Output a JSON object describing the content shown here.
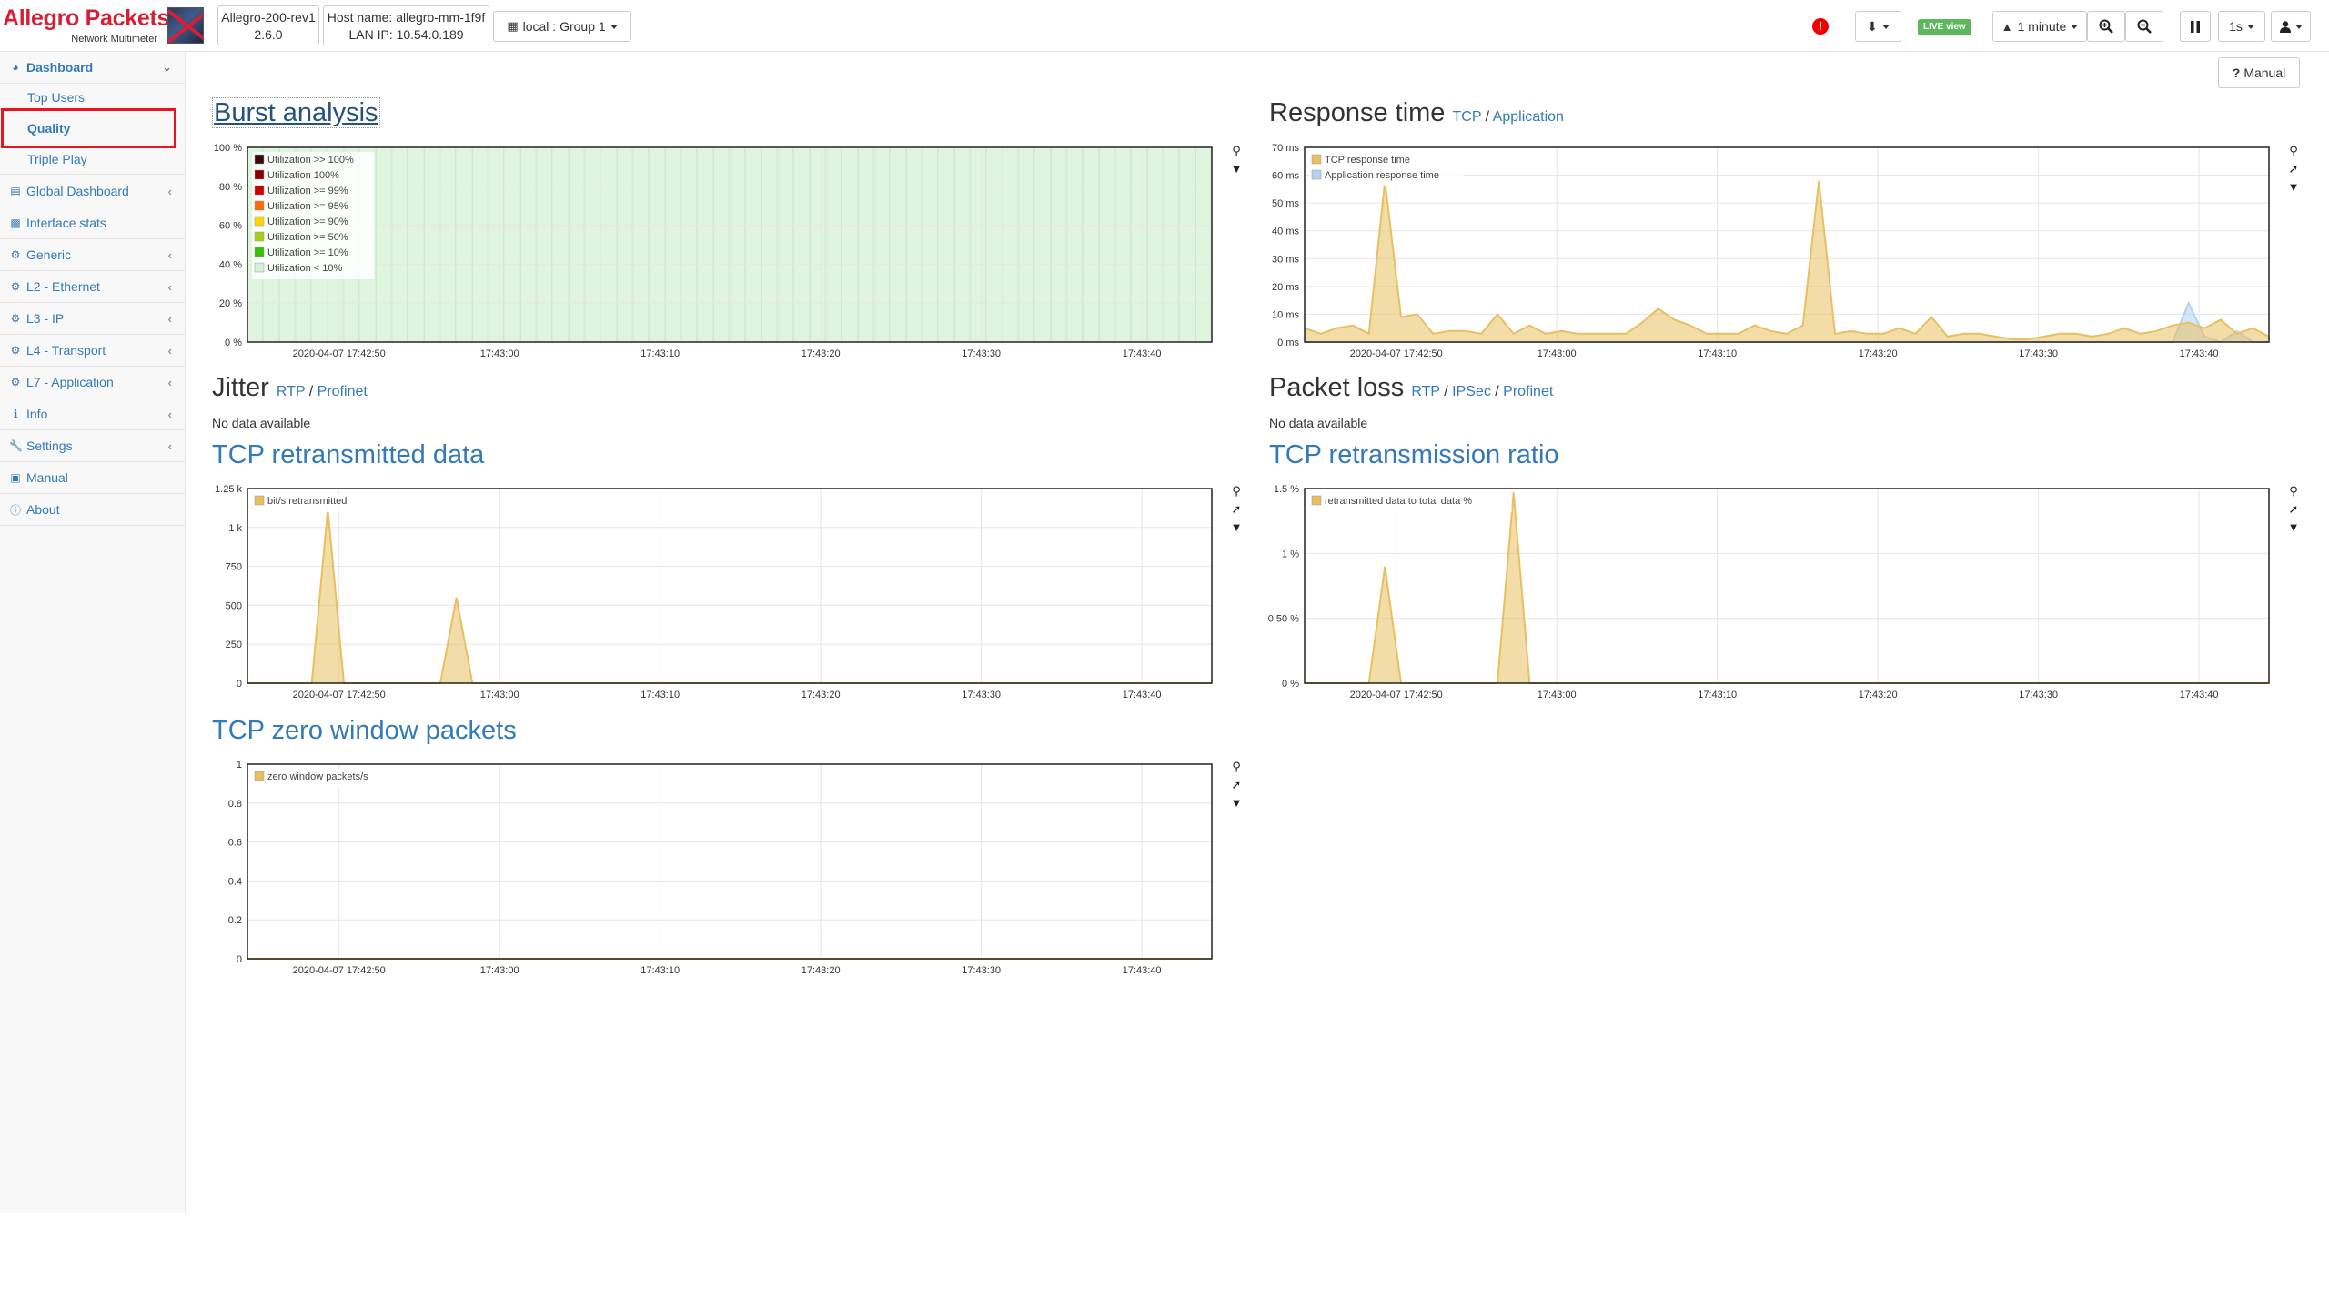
{
  "header": {
    "brand": "Allegro Packets",
    "brand_sub": "Network Multimeter",
    "device_name": "Allegro-200-rev1",
    "device_version": "2.6.0",
    "hostname": "Host name: allegro-mm-1f9f",
    "lan_ip": "LAN IP: 10.54.0.189",
    "group": "local : Group 1",
    "live": "LIVE view",
    "timespan": "1 minute",
    "interval": "1s",
    "alert_glyph": "!",
    "manual": "Manual"
  },
  "sidebar": {
    "dashboard": "Dashboard",
    "sub": [
      "Top Users",
      "Quality",
      "Triple Play"
    ],
    "items": [
      "Global Dashboard",
      "Interface stats",
      "Generic",
      "L2 - Ethernet",
      "L3 - IP",
      "L4 - Transport",
      "L7 - Application",
      "Info",
      "Settings",
      "Manual",
      "About"
    ]
  },
  "panels": {
    "burst": {
      "title": "Burst analysis"
    },
    "response": {
      "title": "Response time",
      "links": [
        "TCP",
        "Application"
      ]
    },
    "jitter": {
      "title": "Jitter",
      "links": [
        "RTP",
        "Profinet"
      ],
      "nodata": "No data available"
    },
    "packetloss": {
      "title": "Packet loss",
      "links": [
        "RTP",
        "IPSec",
        "Profinet"
      ],
      "nodata": "No data available"
    },
    "retrans": {
      "title": "TCP retransmitted data"
    },
    "ratio": {
      "title": "TCP retransmission ratio"
    },
    "zero": {
      "title": "TCP zero window packets"
    }
  },
  "colors": {
    "accent": "#337ab7",
    "brand": "#d51f35",
    "series_yellow": "#e8c061",
    "series_blue": "#b0d3ef",
    "burst_green": "#dff5df"
  },
  "chart_data": [
    {
      "id": "burst",
      "type": "area",
      "x": [
        "2020-04-07 17:42:50",
        "17:43:00",
        "17:43:10",
        "17:43:20",
        "17:43:30",
        "17:43:40"
      ],
      "yticks": [
        "100 %",
        "80 %",
        "60 %",
        "40 %",
        "20 %",
        "0 %"
      ],
      "ylim": [
        0,
        100
      ],
      "legend": [
        {
          "name": "Utilization >> 100%",
          "color": "#3a0a0a"
        },
        {
          "name": "Utilization 100%",
          "color": "#8b0000"
        },
        {
          "name": "Utilization >= 99%",
          "color": "#cc0000"
        },
        {
          "name": "Utilization >= 95%",
          "color": "#ff6a00"
        },
        {
          "name": "Utilization >= 90%",
          "color": "#ffd500"
        },
        {
          "name": "Utilization >= 50%",
          "color": "#a8cc18"
        },
        {
          "name": "Utilization >= 10%",
          "color": "#39c000"
        },
        {
          "name": "Utilization < 10%",
          "color": "#d6f0d6"
        }
      ],
      "values": [
        100,
        100,
        100,
        100,
        100,
        100,
        100,
        100,
        100,
        100,
        100,
        100,
        100,
        100,
        100,
        100,
        100,
        100,
        100,
        100,
        100,
        100,
        100,
        100,
        100,
        100,
        100,
        100,
        100,
        100,
        100,
        100,
        100,
        100,
        100,
        100,
        100,
        100,
        100,
        100,
        100,
        100,
        100,
        100,
        100,
        100,
        100,
        100,
        100,
        100,
        100,
        100,
        100,
        100,
        100,
        100,
        100,
        100,
        100,
        100
      ]
    },
    {
      "id": "response",
      "type": "area",
      "x": [
        "2020-04-07 17:42:50",
        "17:43:00",
        "17:43:10",
        "17:43:20",
        "17:43:30",
        "17:43:40"
      ],
      "yticks": [
        "70 ms",
        "60 ms",
        "50 ms",
        "40 ms",
        "30 ms",
        "20 ms",
        "10 ms",
        "0 ms"
      ],
      "ylim": [
        0,
        70
      ],
      "series": [
        {
          "name": "TCP response time",
          "color": "#e8c061",
          "values": [
            5,
            3,
            5,
            6,
            3,
            58,
            9,
            10,
            3,
            4,
            4,
            3,
            10,
            3,
            6,
            3,
            4,
            3,
            3,
            3,
            3,
            7,
            12,
            8,
            6,
            3,
            3,
            3,
            6,
            4,
            3,
            6,
            58,
            3,
            4,
            3,
            3,
            5,
            3,
            9,
            2,
            3,
            3,
            2,
            1,
            1,
            2,
            3,
            3,
            2,
            3,
            5,
            3,
            4,
            6,
            7,
            5,
            8,
            3,
            5,
            2
          ]
        },
        {
          "name": "Application response time",
          "color": "#b0d3ef",
          "values": [
            0,
            0,
            0,
            0,
            0,
            0,
            0,
            0,
            0,
            0,
            0,
            0,
            0,
            0,
            0,
            0,
            0,
            0,
            0,
            0,
            0,
            0,
            0,
            0,
            0,
            0,
            0,
            0,
            0,
            0,
            0,
            0,
            0,
            0,
            0,
            0,
            0,
            0,
            0,
            0,
            0,
            0,
            0,
            0,
            0,
            0,
            0,
            0,
            0,
            0,
            0,
            0,
            0,
            0,
            0,
            14,
            2,
            0,
            4,
            0,
            0
          ]
        }
      ]
    },
    {
      "id": "retrans",
      "type": "area",
      "x": [
        "2020-04-07 17:42:50",
        "17:43:00",
        "17:43:10",
        "17:43:20",
        "17:43:30",
        "17:43:40"
      ],
      "yticks": [
        "1.25 k",
        "1 k",
        "750",
        "500",
        "250",
        "0"
      ],
      "ylim": [
        0,
        1250
      ],
      "series": [
        {
          "name": "bit/s retransmitted",
          "color": "#e8c061",
          "values": [
            0,
            0,
            0,
            0,
            0,
            1120,
            0,
            0,
            0,
            0,
            0,
            0,
            0,
            550,
            0,
            0,
            0,
            0,
            0,
            0,
            0,
            0,
            0,
            0,
            0,
            0,
            0,
            0,
            0,
            0,
            0,
            0,
            0,
            0,
            0,
            0,
            0,
            0,
            0,
            0,
            0,
            0,
            0,
            0,
            0,
            0,
            0,
            0,
            0,
            0,
            0,
            0,
            0,
            0,
            0,
            0,
            0,
            0,
            0,
            0,
            0
          ]
        }
      ]
    },
    {
      "id": "ratio",
      "type": "area",
      "x": [
        "2020-04-07 17:42:50",
        "17:43:00",
        "17:43:10",
        "17:43:20",
        "17:43:30",
        "17:43:40"
      ],
      "yticks": [
        "1.5 %",
        "1 %",
        "0.50 %",
        "0 %"
      ],
      "ylim": [
        0,
        1.5
      ],
      "series": [
        {
          "name": "retransmitted data to total data %",
          "color": "#e8c061",
          "values": [
            0,
            0,
            0,
            0,
            0,
            0.9,
            0,
            0,
            0,
            0,
            0,
            0,
            0,
            1.47,
            0,
            0,
            0,
            0,
            0,
            0,
            0,
            0,
            0,
            0,
            0,
            0,
            0,
            0,
            0,
            0,
            0,
            0,
            0,
            0,
            0,
            0,
            0,
            0,
            0,
            0,
            0,
            0,
            0,
            0,
            0,
            0,
            0,
            0,
            0,
            0,
            0,
            0,
            0,
            0,
            0,
            0,
            0,
            0,
            0,
            0,
            0
          ]
        }
      ]
    },
    {
      "id": "zero",
      "type": "area",
      "x": [
        "2020-04-07 17:42:50",
        "17:43:00",
        "17:43:10",
        "17:43:20",
        "17:43:30",
        "17:43:40"
      ],
      "yticks": [
        "1",
        "0.8",
        "0.6",
        "0.4",
        "0.2",
        "0"
      ],
      "ylim": [
        0,
        1
      ],
      "series": [
        {
          "name": "zero window packets/s",
          "color": "#e8c061",
          "values": [
            0,
            0,
            0,
            0,
            0,
            0,
            0,
            0,
            0,
            0,
            0,
            0,
            0,
            0,
            0,
            0,
            0,
            0,
            0,
            0,
            0,
            0,
            0,
            0,
            0,
            0,
            0,
            0,
            0,
            0,
            0,
            0,
            0,
            0,
            0,
            0,
            0,
            0,
            0,
            0,
            0,
            0,
            0,
            0,
            0,
            0,
            0,
            0,
            0,
            0,
            0,
            0,
            0,
            0,
            0,
            0,
            0,
            0,
            0,
            0,
            0
          ]
        }
      ]
    }
  ]
}
